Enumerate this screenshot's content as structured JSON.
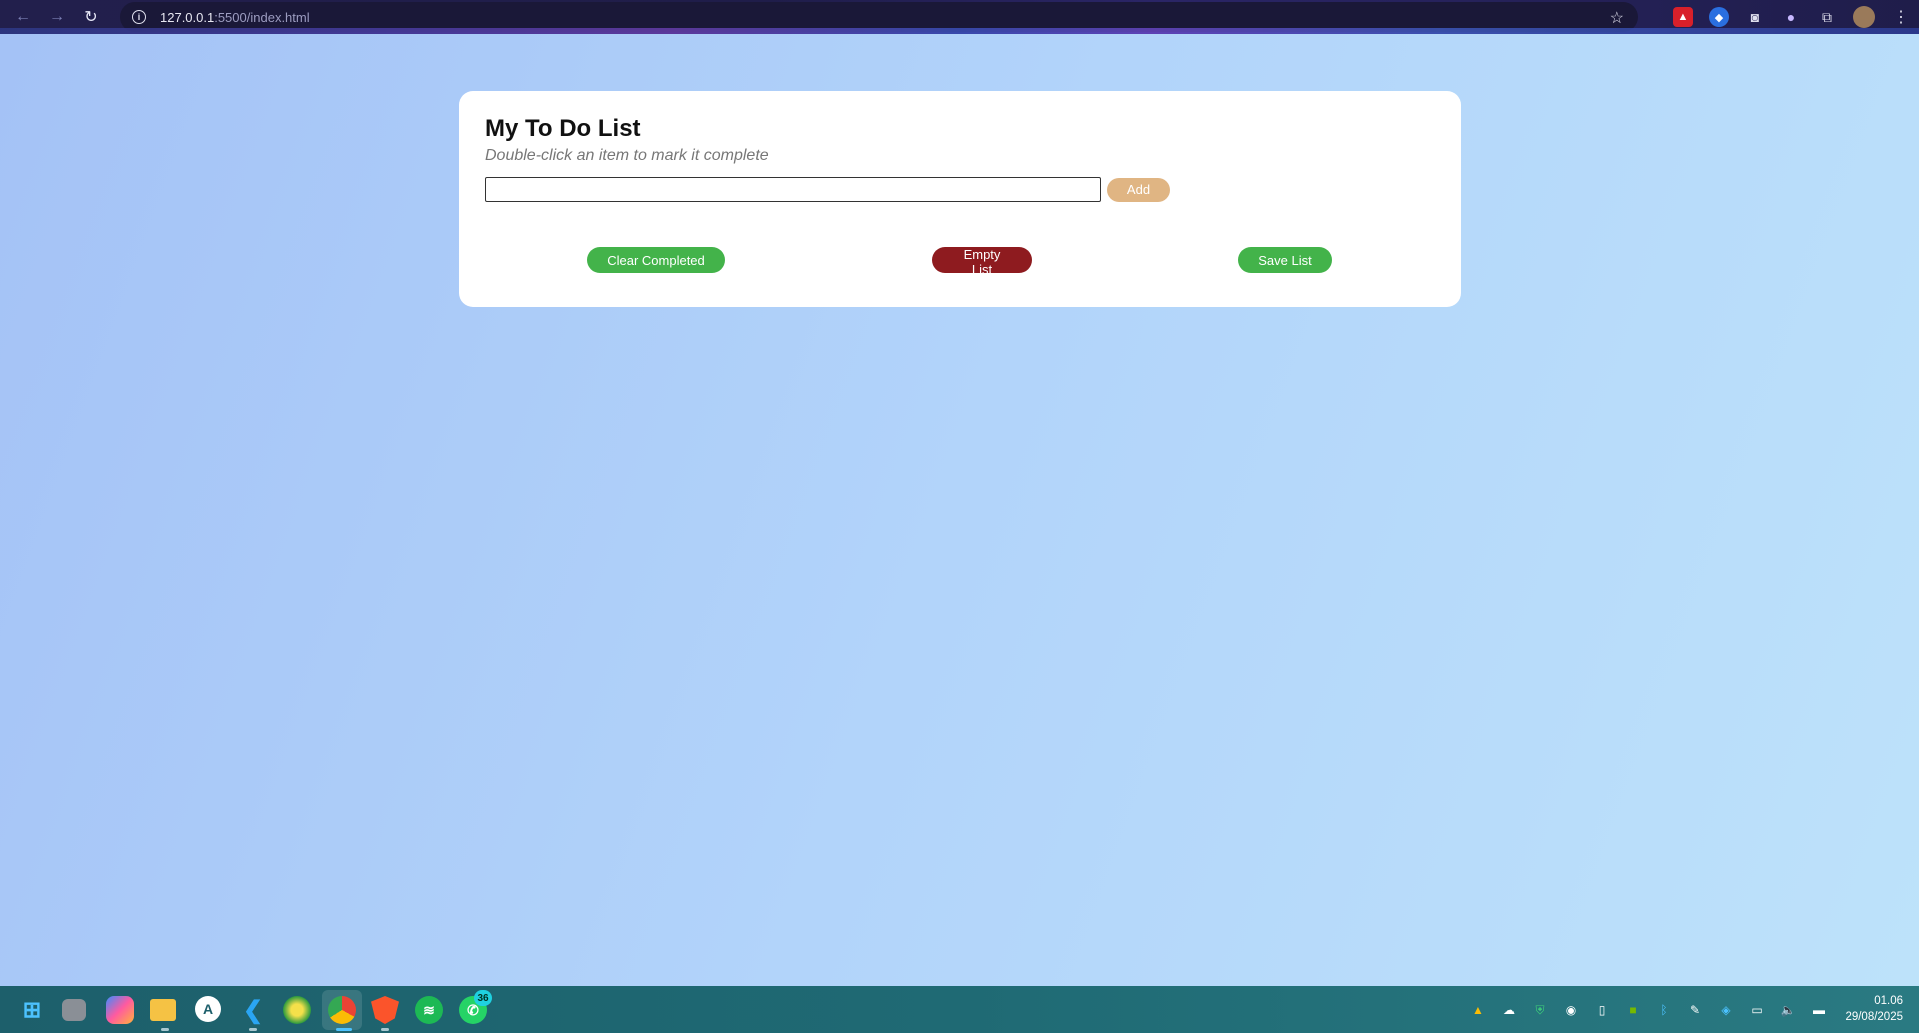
{
  "browser": {
    "back_icon": "arrow-left-icon",
    "forward_icon": "arrow-right-icon",
    "reload_icon": "reload-icon",
    "url_host": "127.0.0.1",
    "url_rest": ":5500/index.html",
    "bookmark_icon": "star-icon",
    "extensions": [
      "extension-red-icon",
      "extension-blue-icon",
      "camera-icon",
      "extension-purple-icon",
      "puzzle-icon",
      "profile-avatar-icon",
      "menu-dots-icon"
    ]
  },
  "app": {
    "title": "My To Do List",
    "subtitle": "Double-click an item to mark it complete",
    "input": {
      "value": "",
      "placeholder": ""
    },
    "add_label": "Add",
    "clear_completed_label": "Clear Completed",
    "empty_list_label": "Empty List",
    "save_list_label": "Save List"
  },
  "colors": {
    "add_button": "#e0b583",
    "green_button": "#43b34a",
    "red_button": "#8e1b1f"
  },
  "taskbar": {
    "apps": [
      "start-icon",
      "task-view-icon",
      "copilot-icon",
      "file-explorer-icon",
      "app-store-icon",
      "vscode-icon",
      "app-green-icon",
      "chrome-icon",
      "brave-icon",
      "spotify-icon",
      "whatsapp-icon"
    ],
    "whatsapp_badge": "36",
    "tray": [
      "google-drive-icon",
      "onedrive-icon",
      "shield-icon",
      "steam-icon",
      "usb-icon",
      "nvidia-icon",
      "bluetooth-icon",
      "app-tray-icon",
      "security-icon",
      "network-icon",
      "volume-icon",
      "battery-icon"
    ],
    "time": "01.06",
    "date": "29/08/2025"
  }
}
